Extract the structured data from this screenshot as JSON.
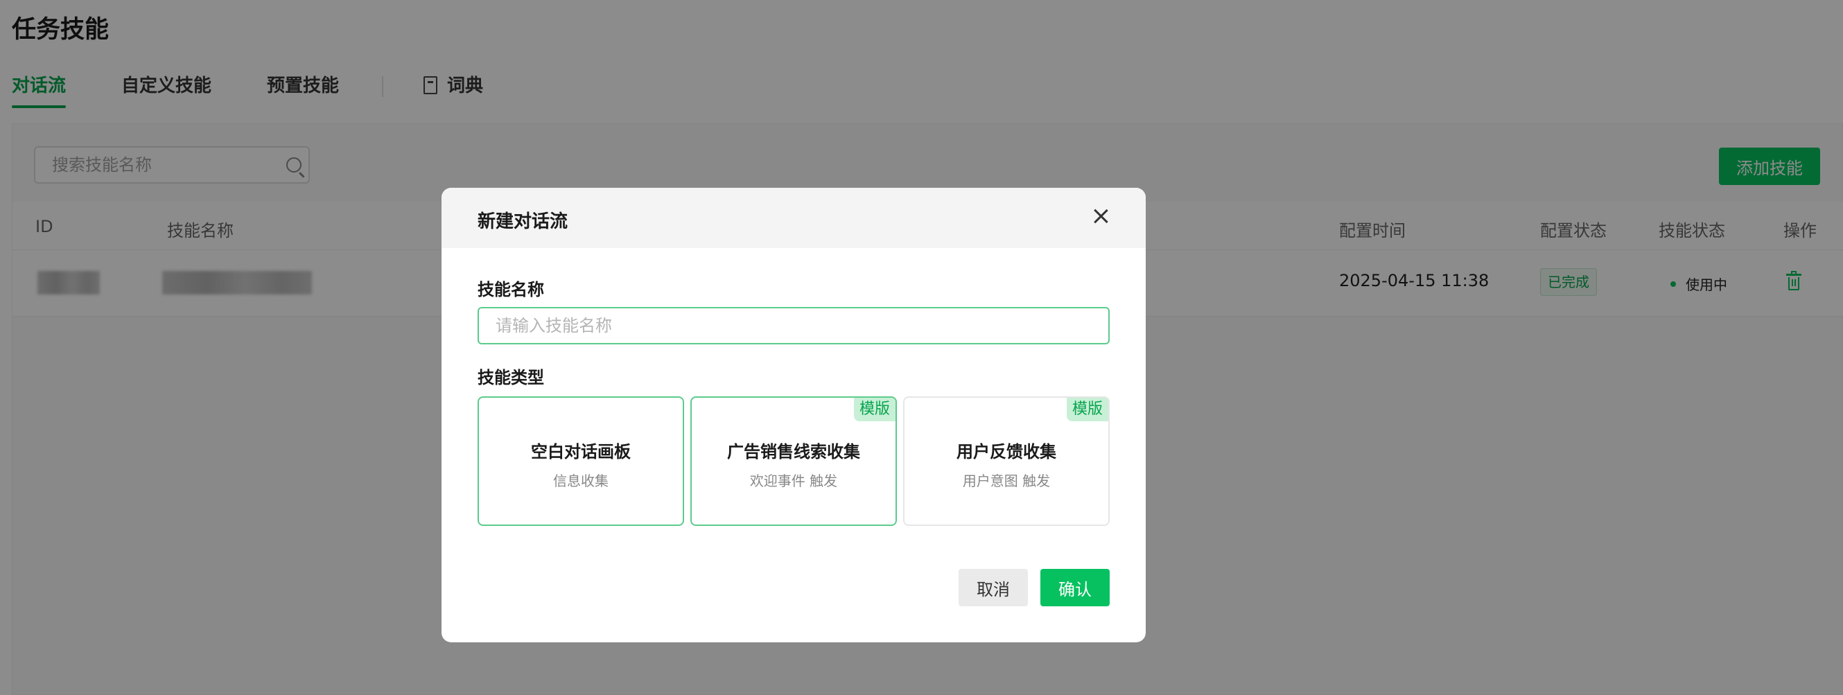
{
  "page": {
    "title": "任务技能",
    "tabs": [
      {
        "label": "对话流",
        "active": true
      },
      {
        "label": "自定义技能",
        "active": false
      },
      {
        "label": "预置技能",
        "active": false
      },
      {
        "label": "词典",
        "active": false,
        "icon": "book-icon"
      }
    ]
  },
  "toolbar": {
    "search_placeholder": "搜索技能名称",
    "add_label": "添加技能"
  },
  "table": {
    "columns": [
      "ID",
      "技能名称",
      "配置时间",
      "配置状态",
      "技能状态",
      "操作"
    ],
    "rows": [
      {
        "id": "",
        "name": "",
        "config_time": "2025-04-15 11:38",
        "config_status": "已完成",
        "skill_status": "使用中",
        "action_icon": "trash-icon"
      }
    ]
  },
  "modal": {
    "title": "新建对话流",
    "name_label": "技能名称",
    "name_placeholder": "请输入技能名称",
    "type_label": "技能类型",
    "types": [
      {
        "title": "空白对话画板",
        "subtitle": "信息收集",
        "badge": ""
      },
      {
        "title": "广告销售线索收集",
        "subtitle": "欢迎事件 触发",
        "badge": "模版"
      },
      {
        "title": "用户反馈收集",
        "subtitle": "用户意图 触发",
        "badge": "模版"
      }
    ],
    "cancel_label": "取消",
    "confirm_label": "确认"
  },
  "colors": {
    "accent": "#07c160",
    "accent_text": "#07a44e",
    "overlay": "rgba(0,0,0,0.45)"
  }
}
